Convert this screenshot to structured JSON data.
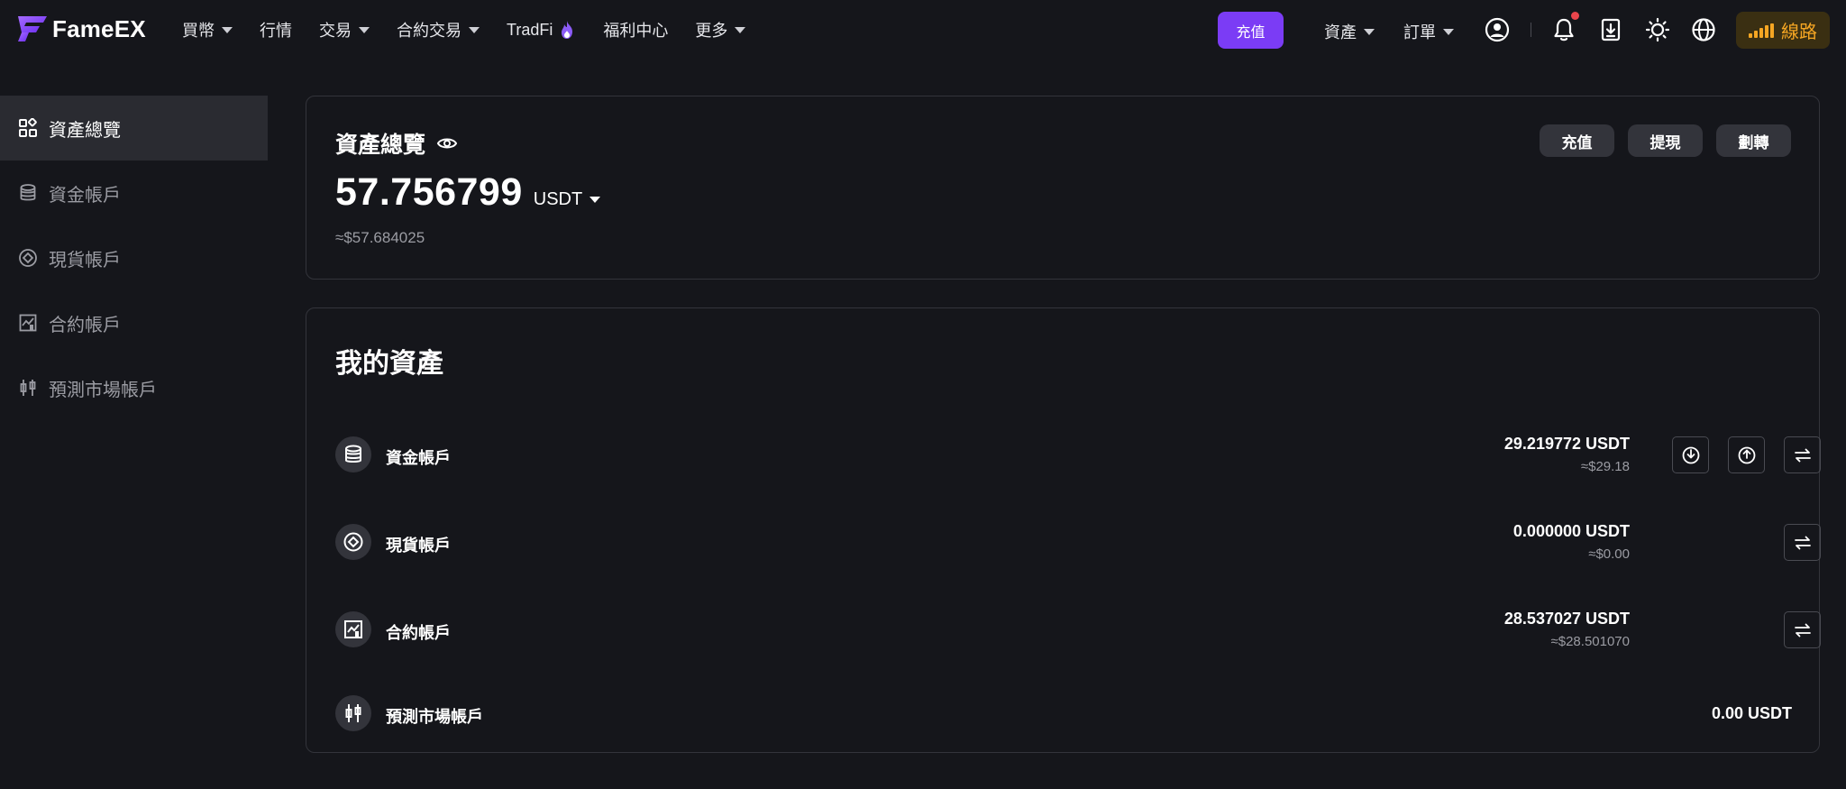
{
  "brand": {
    "name": "FameEX"
  },
  "nav": [
    {
      "label": "買幣",
      "dropdown": true
    },
    {
      "label": "行情",
      "dropdown": false
    },
    {
      "label": "交易",
      "dropdown": true
    },
    {
      "label": "合約交易",
      "dropdown": true
    },
    {
      "label": "TradFi",
      "dropdown": false,
      "icon": "fire-icon"
    },
    {
      "label": "福利中心",
      "dropdown": false
    },
    {
      "label": "更多",
      "dropdown": true
    }
  ],
  "topRight": {
    "deposit_label": "充值",
    "assets_label": "資產",
    "orders_label": "訂單",
    "line_label": "線路",
    "icons": [
      "user-icon",
      "bell-icon",
      "download-icon",
      "sun-icon",
      "globe-icon",
      "signal-icon"
    ]
  },
  "sidebar": [
    {
      "label": "資產總覽",
      "icon": "grid-icon",
      "active": true
    },
    {
      "label": "資金帳戶",
      "icon": "database-icon",
      "active": false
    },
    {
      "label": "現貨帳戶",
      "icon": "spot-icon",
      "active": false
    },
    {
      "label": "合約帳戶",
      "icon": "chart-icon",
      "active": false
    },
    {
      "label": "預測市場帳戶",
      "icon": "candlestick-icon",
      "active": false
    }
  ],
  "overview": {
    "title": "資產總覽",
    "amount": "57.756799",
    "currency": "USDT",
    "approx": "≈$57.684025",
    "buttons": {
      "deposit": "充值",
      "withdraw": "提現",
      "transfer": "劃轉"
    }
  },
  "assets": {
    "title": "我的資產",
    "accounts": [
      {
        "name": "資金帳戶",
        "icon": "database-icon",
        "value": "29.219772 USDT",
        "approx": "≈$29.18",
        "actions": [
          "deposit",
          "withdraw",
          "transfer"
        ]
      },
      {
        "name": "現貨帳戶",
        "icon": "spot-icon",
        "value": "0.000000 USDT",
        "approx": "≈$0.00",
        "actions": [
          "transfer"
        ]
      },
      {
        "name": "合約帳戶",
        "icon": "chart-icon",
        "value": "28.537027 USDT",
        "approx": "≈$28.501070",
        "actions": [
          "transfer"
        ]
      },
      {
        "name": "預測市場帳戶",
        "icon": "candlestick-icon",
        "value": "0.00 USDT",
        "approx": "",
        "actions": []
      }
    ]
  },
  "colors": {
    "accent": "#7b3cf5",
    "line": "#f5a623",
    "background": "#15161b",
    "notification": "#e9454c"
  }
}
